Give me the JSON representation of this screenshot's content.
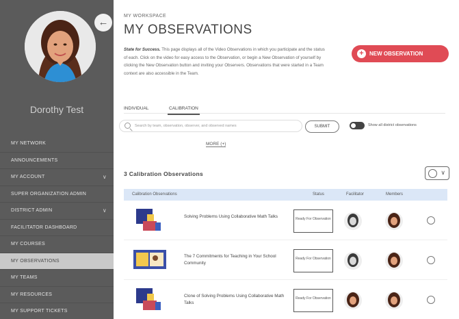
{
  "sidebar": {
    "user_name": "Dorothy Test",
    "nav": [
      {
        "label": "MY NETWORK",
        "chevron": false,
        "active": false
      },
      {
        "label": "ANNOUNCEMENTS",
        "chevron": false,
        "active": false
      },
      {
        "label": "MY ACCOUNT",
        "chevron": true,
        "active": false
      },
      {
        "label": "SUPER ORGANIZATION ADMIN",
        "chevron": false,
        "active": false
      },
      {
        "label": "DISTRICT ADMIN",
        "chevron": true,
        "active": false
      },
      {
        "label": "FACILITATOR DASHBOARD",
        "chevron": false,
        "active": false
      },
      {
        "label": "MY COURSES",
        "chevron": false,
        "active": false
      },
      {
        "label": "MY OBSERVATIONS",
        "chevron": false,
        "active": true
      },
      {
        "label": "MY TEAMS",
        "chevron": false,
        "active": false
      },
      {
        "label": "MY RESOURCES",
        "chevron": false,
        "active": false
      },
      {
        "label": "MY SUPPORT TICKETS",
        "chevron": false,
        "active": false
      }
    ]
  },
  "header": {
    "kicker": "MY WORKSPACE",
    "title": "MY OBSERVATIONS",
    "desc_lead": "State for Success.",
    "desc_body": "This page displays all of the Video Observations in which you participate and the status of each. Click on the video for easy access to the Observation, or begin a New Observation of yourself by clicking the New Observation button and inviting your Observers. Observations that were started in a Team context are also accessible in the Team.",
    "new_button": "NEW OBSERVATION"
  },
  "tabs": [
    "INDIVIDUAL",
    "CALIBRATION"
  ],
  "search": {
    "placeholder": "Search by team, observation, observer, and observed names",
    "submit": "SUBMIT",
    "toggle_label": "Show all district observations",
    "more": "MORE (+)"
  },
  "list": {
    "count_label": "3 Calibration Observations",
    "columns": {
      "name": "Calibration Observations",
      "status": "Status",
      "facilitator": "Facilitator",
      "members": "Members"
    },
    "rows": [
      {
        "title": "Solving Problems Using Collaborative Math Talks",
        "status": "Ready For Observation"
      },
      {
        "title": "The 7 Commitments for Teaching in Your School Community",
        "status": "Ready For Observation"
      },
      {
        "title": "Clone of Solving Problems Using Collaborative Math Talks",
        "status": "Ready For Observation"
      }
    ]
  },
  "colors": {
    "sidebar_bg": "#5b5b5b",
    "accent": "#e04b55",
    "table_header_bg": "#dbe7f7"
  }
}
